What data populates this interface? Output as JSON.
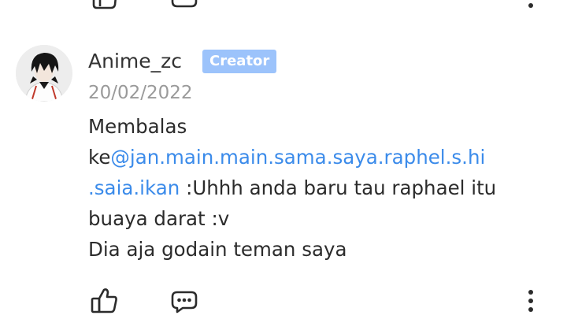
{
  "comment": {
    "author": "Anime_zc",
    "badge": "Creator",
    "date": "20/02/2022",
    "reply_prefix": "Membalas",
    "reply_to_lead": "ke",
    "mention_part1": "@jan.main.main.sama.saya.raphel.s.hi",
    "mention_part2": ".saia.ikan",
    "text_after_mention": " :Uhhh anda baru tau raphael itu",
    "line4": "buaya darat :v",
    "line5": "Dia aja godain teman saya"
  },
  "colors": {
    "badge_bg": "#9cc3fb",
    "mention": "#3b8bea",
    "date": "#9a9a9a"
  },
  "icons": {
    "like": "thumbs-up-icon",
    "reply": "comment-bubble-icon",
    "more": "more-vertical-icon"
  }
}
